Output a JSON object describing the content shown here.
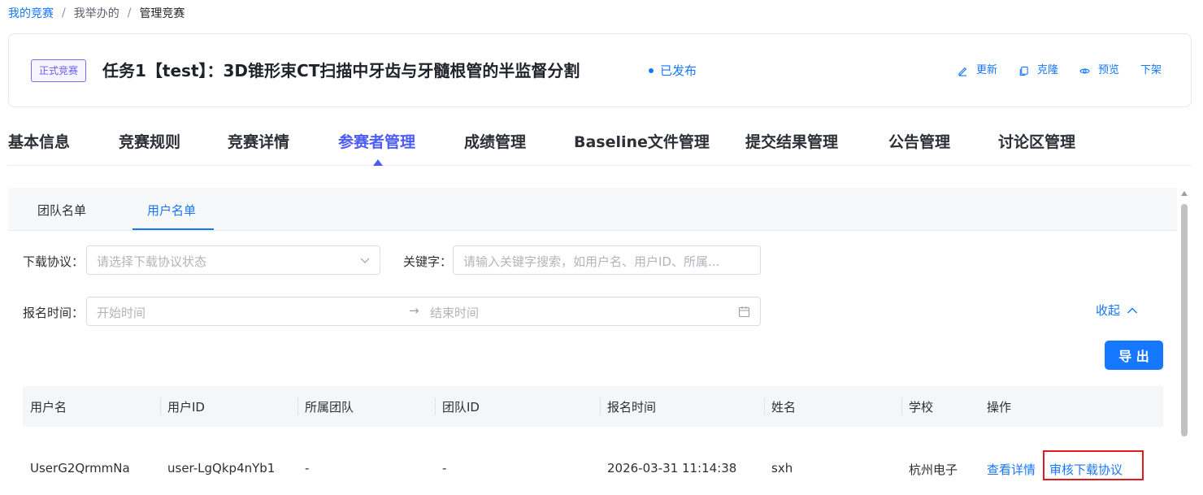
{
  "breadcrumb": {
    "items": [
      "我的竞赛",
      "我举办的",
      "管理竞赛"
    ],
    "separator": "/"
  },
  "header": {
    "badge": "正式竞赛",
    "title": "任务1【test】：3D锥形束CT扫描中牙齿与牙髓根管的半监督分割",
    "status": "已发布",
    "actions": [
      {
        "label": "更新",
        "icon": "edit-icon"
      },
      {
        "label": "克隆",
        "icon": "copy-icon"
      },
      {
        "label": "预览",
        "icon": "eye-icon"
      },
      {
        "label": "下架",
        "icon": ""
      }
    ]
  },
  "tabs": {
    "items": [
      "基本信息",
      "竞赛规则",
      "竞赛详情",
      "参赛者管理",
      "成绩管理",
      "Baseline文件管理",
      "提交结果管理",
      "公告管理",
      "讨论区管理"
    ],
    "active": "参赛者管理"
  },
  "subtabs": {
    "items": [
      "团队名单",
      "用户名单"
    ],
    "active": "用户名单"
  },
  "filters": {
    "agreement_label": "下载协议：",
    "agreement_placeholder": "请选择下载协议状态",
    "keyword_label": "关键字：",
    "keyword_placeholder": "请输入关键字搜索，如用户名、用户ID、所属...",
    "time_label": "报名时间：",
    "start_placeholder": "开始时间",
    "end_placeholder": "结束时间",
    "collapse_label": "收起"
  },
  "export_label": "导 出",
  "table": {
    "columns": [
      "用户名",
      "用户ID",
      "所属团队",
      "团队ID",
      "报名时间",
      "姓名",
      "学校",
      "操作"
    ],
    "rows": [
      {
        "username": "UserG2QrmmNa",
        "user_id": "user-LgQkp4nYb1",
        "team": "-",
        "team_id": "-",
        "signup_time": "2026-03-31 11:14:38",
        "name": "sxh",
        "school": "杭州电子",
        "actions": [
          "查看详情",
          "审核下载协议"
        ]
      }
    ]
  },
  "colors": {
    "accent": "#1677ff",
    "tab_active": "#4d5cf5",
    "badge": "#6a5cf0",
    "highlight": "#e01b1b"
  }
}
